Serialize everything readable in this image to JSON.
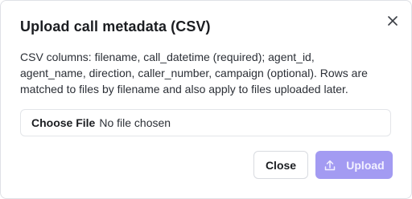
{
  "dialog": {
    "title": "Upload call metadata (CSV)",
    "description": "CSV columns: filename, call_datetime (required); agent_id, agent_name, direction, caller_number, campaign (optional). Rows are matched to files by filename and also apply to files uploaded later.",
    "file_input": {
      "button_label": "Choose File",
      "status": "No file chosen"
    },
    "buttons": {
      "close_label": "Close",
      "upload_label": "Upload"
    },
    "icons": {
      "close": "close-icon",
      "upload": "upload-icon"
    },
    "colors": {
      "accent_disabled": "#a39bf2"
    }
  }
}
